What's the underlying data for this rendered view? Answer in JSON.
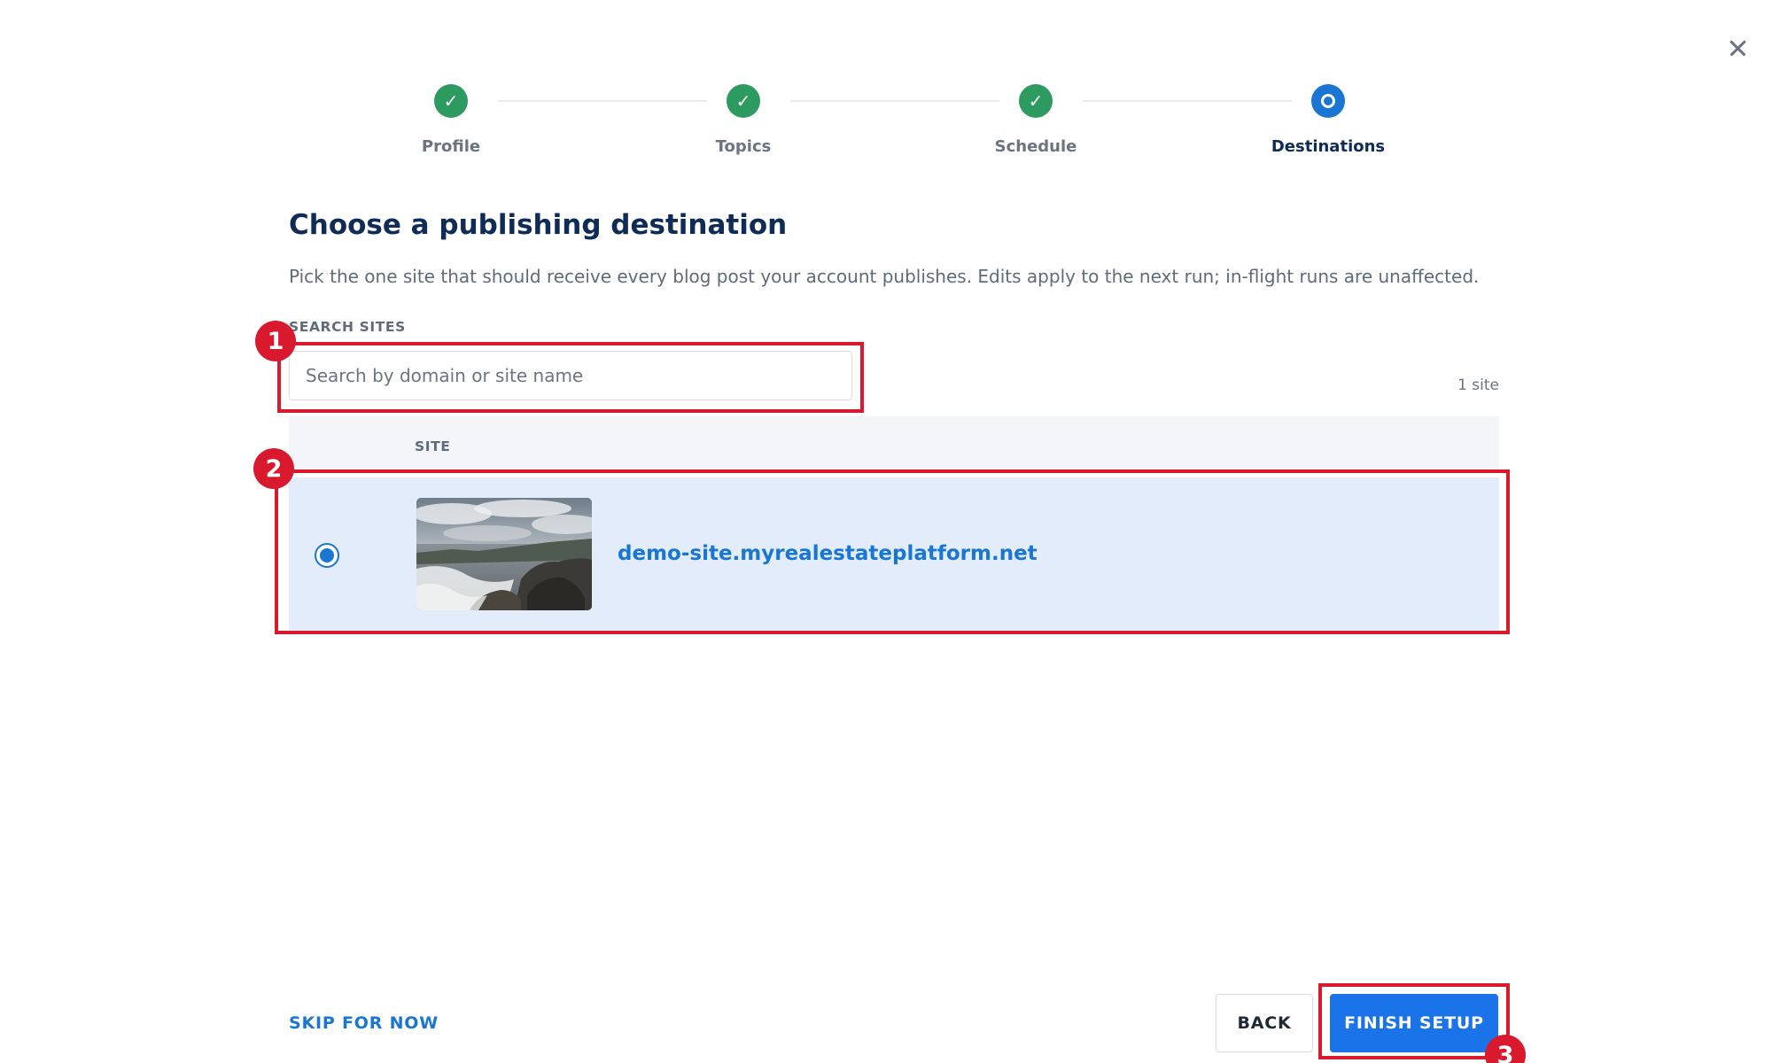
{
  "close_icon": "close-icon",
  "stepper": {
    "steps": [
      {
        "label": "Profile",
        "status": "done",
        "icon": "✓"
      },
      {
        "label": "Topics",
        "status": "done",
        "icon": "✓"
      },
      {
        "label": "Schedule",
        "status": "done",
        "icon": "✓"
      },
      {
        "label": "Destinations",
        "status": "current"
      }
    ]
  },
  "page": {
    "title": "Choose a publishing destination",
    "subtitle": "Pick the one site that should receive every blog post your account publishes. Edits apply to the next run; in-flight runs are unaffected."
  },
  "search": {
    "label": "SEARCH SITES",
    "placeholder": "Search by domain or site name",
    "value": "",
    "count": "1 site"
  },
  "table": {
    "column_site": "SITE",
    "rows": [
      {
        "name": "demo-site.myrealestateplatform.net",
        "selected": true,
        "thumbnail": "coastal-rocks-photo"
      }
    ]
  },
  "footer": {
    "skip_label": "SKIP FOR NOW",
    "back_label": "BACK",
    "finish_label": "FINISH SETUP"
  },
  "annotations": [
    "1",
    "2",
    "3"
  ],
  "colors": {
    "accent": "#1a73e8",
    "heading": "#0f2b57",
    "success": "#2d9a5f",
    "selected_row": "#e3ecfb",
    "annotation": "#d8192e"
  }
}
